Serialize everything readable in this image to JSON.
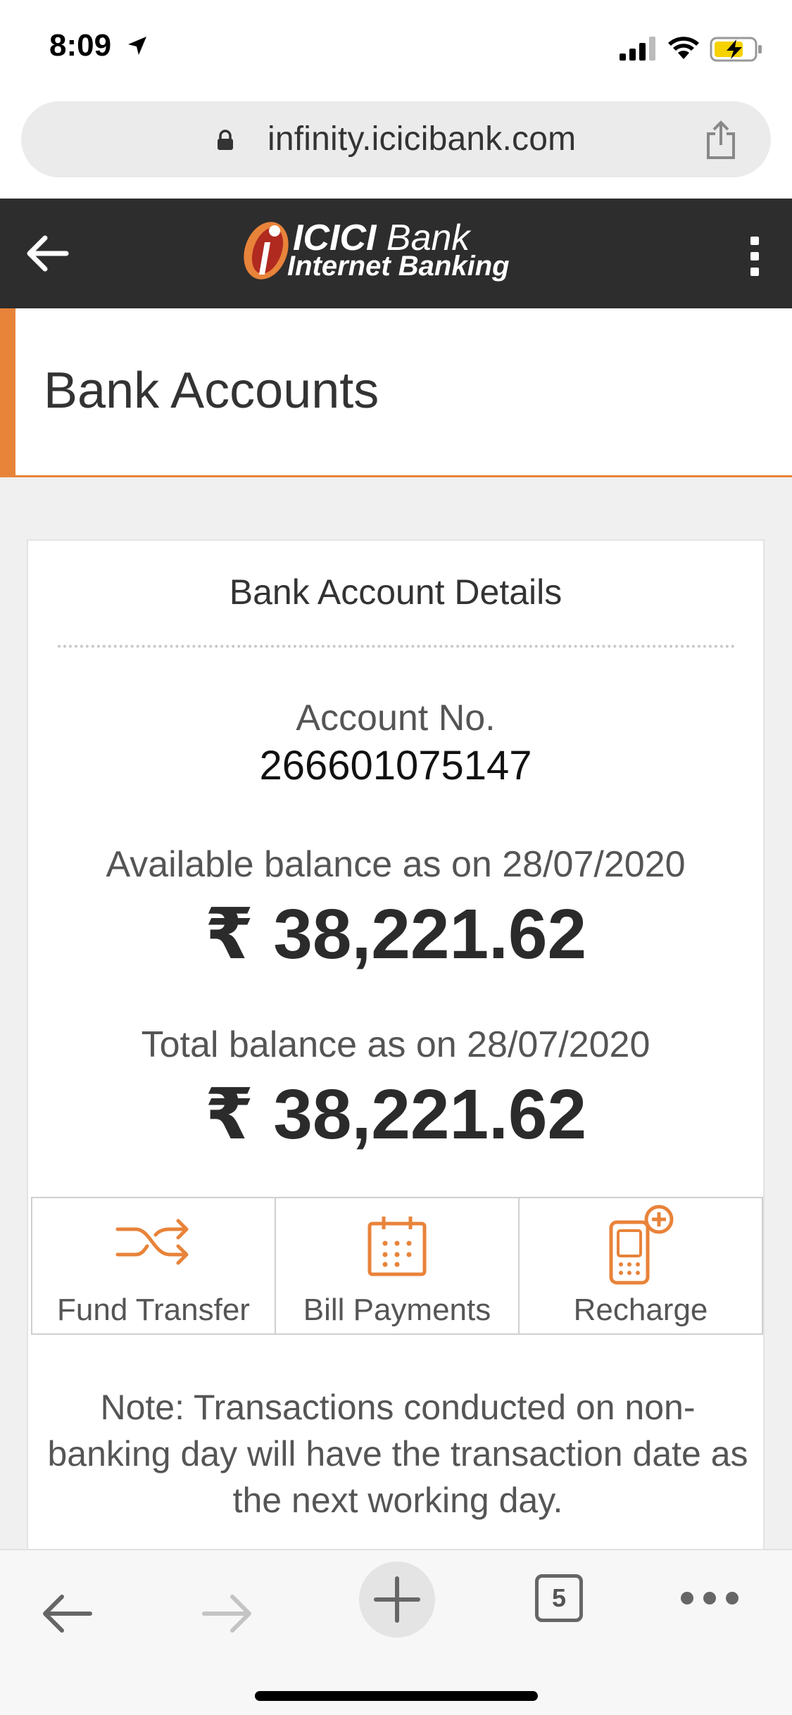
{
  "status_bar": {
    "time": "8:09"
  },
  "browser": {
    "url": "infinity.icicibank.com",
    "tab_count": "5"
  },
  "header": {
    "logo_brand": "ICICI",
    "logo_bank": "Bank",
    "logo_subtitle": "Internet Banking",
    "accent_color": "#e8833a"
  },
  "page": {
    "title": "Bank Accounts"
  },
  "account_card": {
    "title": "Bank Account Details",
    "account_label": "Account No.",
    "account_number": "266601075147",
    "available_label": "Available balance as on 28/07/2020",
    "available_amount": "₹ 38,221.62",
    "total_label": "Total balance as on 28/07/2020",
    "total_amount": "₹ 38,221.62"
  },
  "actions": [
    {
      "label": "Fund Transfer",
      "icon": "shuffle-icon"
    },
    {
      "label": "Bill Payments",
      "icon": "calendar-icon"
    },
    {
      "label": "Recharge",
      "icon": "mobile-recharge-icon"
    }
  ],
  "note": "Note: Transactions conducted on non-banking day will have the transaction date as the next working day."
}
